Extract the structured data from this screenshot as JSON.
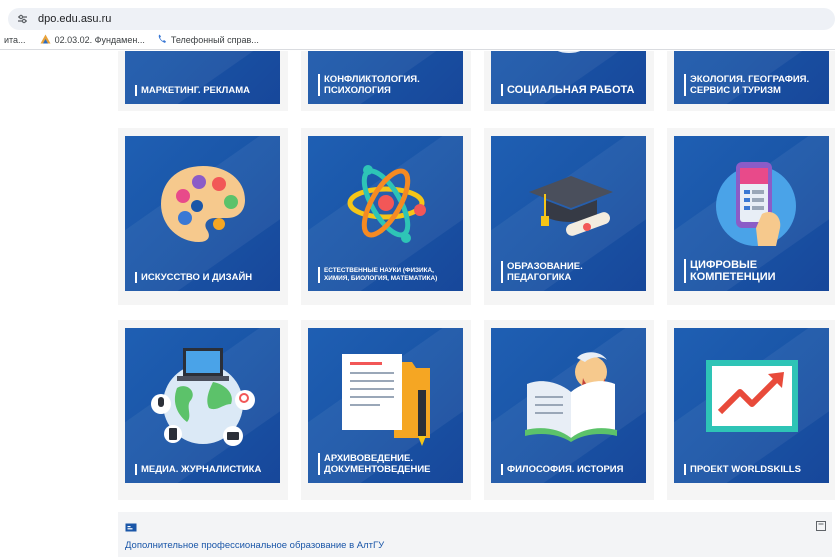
{
  "browser": {
    "url": "dpo.edu.asu.ru",
    "bookmarks": [
      {
        "label": "ита..."
      },
      {
        "label": "02.03.02. Фундамен..."
      },
      {
        "label": "Телефонный справ..."
      }
    ]
  },
  "tiles": [
    {
      "label": "МАРКЕТИНГ. РЕКЛАМА"
    },
    {
      "label": "КОНФЛИКТОЛОГИЯ. ПСИХОЛОГИЯ"
    },
    {
      "label": "СОЦИАЛЬНАЯ РАБОТА"
    },
    {
      "label": "ЭКОЛОГИЯ. ГЕОГРАФИЯ. СЕРВИС И ТУРИЗМ"
    },
    {
      "label": "ИСКУССТВО И ДИЗАЙН"
    },
    {
      "label": "ЕСТЕСТВЕННЫЕ НАУКИ (ФИЗИКА, ХИМИЯ, БИОЛОГИЯ, МАТЕМАТИКА)"
    },
    {
      "label": "ОБРАЗОВАНИЕ. ПЕДАГОГИКА"
    },
    {
      "label": "ЦИФРОВЫЕ КОМПЕТЕНЦИИ"
    },
    {
      "label": "МЕДИА. ЖУРНАЛИСТИКА"
    },
    {
      "label": "АРХИВОВЕДЕНИЕ. ДОКУМЕНТОВЕДЕНИЕ"
    },
    {
      "label": "ФИЛОСОФИЯ. ИСТОРИЯ"
    },
    {
      "label": "ПРОЕКТ WORLDSKILLS"
    }
  ],
  "footer": {
    "link": "Дополнительное профессиональное образование в АлтГУ"
  }
}
